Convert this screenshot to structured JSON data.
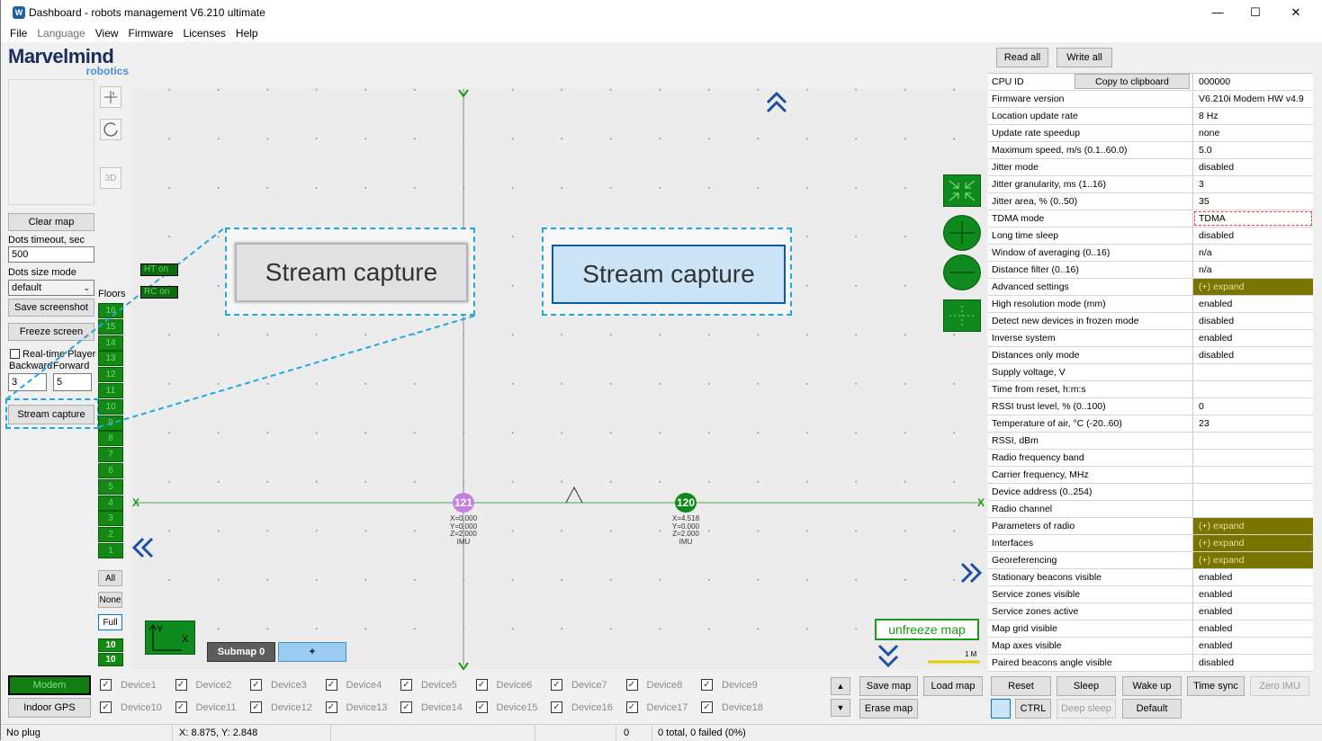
{
  "window": {
    "title": "Dashboard - robots management  V6.210  ultimate",
    "minimize": "—",
    "maximize": "☐",
    "close": "✕"
  },
  "menu": [
    "File",
    "Language",
    "View",
    "Firmware",
    "Licenses",
    "Help"
  ],
  "logo": {
    "name": "Marvelmind",
    "sub": "robotics"
  },
  "left_panel": {
    "clear_map": "Clear map",
    "dots_timeout_label": "Dots timeout, sec",
    "dots_timeout_value": "500",
    "dots_size_label": "Dots size mode",
    "dots_size_value": "default",
    "save_screenshot": "Save screenshot",
    "freeze_screen": "Freeze screen",
    "realtime_player": "Real-time Player",
    "backward": "Backward",
    "forward": "Forward",
    "backward_value": "3",
    "forward_value": "5",
    "stream_capture": "Stream capture",
    "tool_3d": "3D"
  },
  "floors": {
    "label": "Floors",
    "items": [
      "16",
      "15",
      "14",
      "13",
      "12",
      "11",
      "10",
      "9",
      "8",
      "7",
      "6",
      "5",
      "4",
      "3",
      "2",
      "1"
    ],
    "all": "All",
    "none": "None",
    "full": "Full",
    "current_a": "10",
    "current_b": "10"
  },
  "map": {
    "ht_label": "HT on",
    "rc_label": "RC on",
    "callout_left": "Stream capture",
    "callout_right": "Stream capture",
    "axis_x": "X",
    "axis_y": "Y",
    "beacon_a": {
      "id": "121",
      "x": "X=0.000",
      "y": "Y=0.000",
      "z": "Z=2.000",
      "mode": "IMU",
      "color": "#c57fe0"
    },
    "beacon_b": {
      "id": "120",
      "x": "X=4.518",
      "y": "Y=0.000",
      "z": "Z=2.000",
      "mode": "IMU",
      "color": "#0d8a1a"
    },
    "submap": "Submap 0",
    "add_submap": "+",
    "unfreeze": "unfreeze map",
    "scale": "1 M",
    "legend_y": "Y",
    "legend_x": "X"
  },
  "right_panel": {
    "read_all": "Read all",
    "write_all": "Write all",
    "copy_clipboard": "Copy to clipboard",
    "rows": [
      {
        "k": "CPU ID",
        "v": "000000"
      },
      {
        "k": "Firmware version",
        "v": "V6.210i Modem HW v4.9"
      },
      {
        "k": "Location update rate",
        "v": "8 Hz"
      },
      {
        "k": "Update rate speedup",
        "v": "none"
      },
      {
        "k": "Maximum speed, m/s (0.1..60.0)",
        "v": "5.0"
      },
      {
        "k": "Jitter mode",
        "v": "disabled"
      },
      {
        "k": "Jitter granularity, ms (1..16)",
        "v": "3"
      },
      {
        "k": "Jitter area, % (0..50)",
        "v": "35"
      },
      {
        "k": "TDMA mode",
        "v": "TDMA"
      },
      {
        "k": "Long time sleep",
        "v": "disabled"
      },
      {
        "k": "Window of averaging (0..16)",
        "v": "n/a"
      },
      {
        "k": "Distance filter (0..16)",
        "v": "n/a"
      },
      {
        "k": "Advanced settings",
        "v": "(+) expand"
      },
      {
        "k": "High resolution mode (mm)",
        "v": "enabled"
      },
      {
        "k": "Detect new devices in frozen mode",
        "v": "disabled"
      },
      {
        "k": "Inverse system",
        "v": "enabled"
      },
      {
        "k": "Distances only mode",
        "v": "disabled"
      },
      {
        "k": "Supply voltage, V",
        "v": ""
      },
      {
        "k": "Time from reset, h:m:s",
        "v": ""
      },
      {
        "k": "RSSI trust level, % (0..100)",
        "v": "0"
      },
      {
        "k": "Temperature of air, °C (-20..60)",
        "v": "23"
      },
      {
        "k": "RSSI, dBm",
        "v": ""
      },
      {
        "k": "Radio frequency band",
        "v": ""
      },
      {
        "k": "Carrier frequency, MHz",
        "v": ""
      },
      {
        "k": "Device address (0..254)",
        "v": ""
      },
      {
        "k": "Radio channel",
        "v": ""
      },
      {
        "k": "Parameters of radio",
        "v": "(+) expand"
      },
      {
        "k": "Interfaces",
        "v": "(+) expand"
      },
      {
        "k": "Georeferencing",
        "v": "(+) expand"
      },
      {
        "k": "Stationary beacons visible",
        "v": "enabled"
      },
      {
        "k": "Service zones visible",
        "v": "enabled"
      },
      {
        "k": "Service zones active",
        "v": "enabled"
      },
      {
        "k": "Map grid visible",
        "v": "enabled"
      },
      {
        "k": "Map axes visible",
        "v": "enabled"
      },
      {
        "k": "Paired beacons angle visible",
        "v": "disabled"
      }
    ]
  },
  "bottom": {
    "modem": "Modem",
    "indoor_gps": "Indoor GPS",
    "devices_row1": [
      "Device1",
      "Device2",
      "Device3",
      "Device4",
      "Device5",
      "Device6",
      "Device7",
      "Device8",
      "Device9"
    ],
    "devices_row2": [
      "Device10",
      "Device11",
      "Device12",
      "Device13",
      "Device14",
      "Device15",
      "Device16",
      "Device17",
      "Device18"
    ],
    "save_map": "Save map",
    "load_map": "Load map",
    "erase_map": "Erase map",
    "reset": "Reset",
    "sleep": "Sleep",
    "wake_up": "Wake up",
    "time_sync": "Time sync",
    "zero_imu": "Zero IMU",
    "ctrl": "CTRL",
    "deep_sleep": "Deep sleep",
    "default": "Default"
  },
  "status": {
    "conn": "No plug",
    "pos": "X: 8.875, Y: 2.848",
    "count": "0",
    "total": "0 total, 0 failed (0%)"
  }
}
